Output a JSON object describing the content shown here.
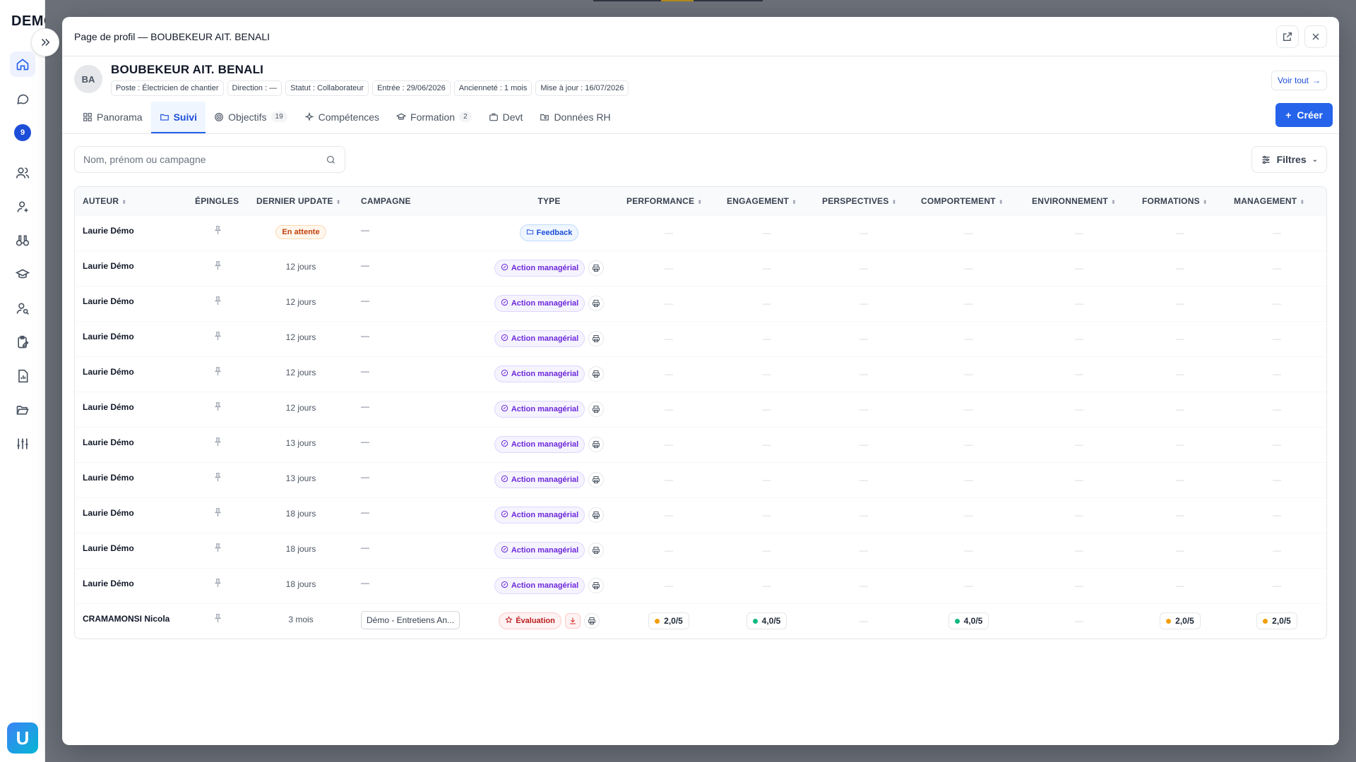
{
  "app": {
    "brand": "DEMO",
    "notif_count": "9"
  },
  "modal": {
    "title": "Page de profil — BOUBEKEUR AIT. BENALI"
  },
  "profile": {
    "initials": "BA",
    "name": "BOUBEKEUR AIT. BENALI",
    "chips": [
      "Poste : Électricien de chantier",
      "Direction : —",
      "Statut : Collaborateur",
      "Entrée : 29/06/2026",
      "Ancienneté : 1 mois",
      "Mise à jour : 16/07/2026"
    ],
    "see_all": "Voir tout"
  },
  "tabs": [
    {
      "label": "Panorama",
      "count": ""
    },
    {
      "label": "Suivi",
      "count": ""
    },
    {
      "label": "Objectifs",
      "count": "19"
    },
    {
      "label": "Compétences",
      "count": ""
    },
    {
      "label": "Formation",
      "count": "2"
    },
    {
      "label": "Devt",
      "count": ""
    },
    {
      "label": "Données RH",
      "count": ""
    }
  ],
  "create_label": "Créer",
  "search": {
    "placeholder": "Nom, prénom ou campagne"
  },
  "filters_label": "Filtres",
  "table": {
    "headers": [
      "AUTEUR",
      "ÉPINGLES",
      "DERNIER UPDATE",
      "CAMPAGNE",
      "TYPE",
      "PERFORMANCE",
      "ENGAGEMENT",
      "PERSPECTIVES",
      "COMPORTEMENT",
      "ENVIRONNEMENT",
      "FORMATIONS",
      "MANAGEMENT"
    ],
    "rows": [
      {
        "author": "Laurie Démo",
        "update": "En attente",
        "campaign": "—",
        "type": "Feedback",
        "scores": [
          "—",
          "—",
          "—",
          "—",
          "—",
          "—",
          "—"
        ]
      },
      {
        "author": "Laurie Démo",
        "update": "12 jours",
        "campaign": "—",
        "type": "Action managérial",
        "scores": [
          "—",
          "—",
          "—",
          "—",
          "—",
          "—",
          "—"
        ]
      },
      {
        "author": "Laurie Démo",
        "update": "12 jours",
        "campaign": "—",
        "type": "Action managérial",
        "scores": [
          "—",
          "—",
          "—",
          "—",
          "—",
          "—",
          "—"
        ]
      },
      {
        "author": "Laurie Démo",
        "update": "12 jours",
        "campaign": "—",
        "type": "Action managérial",
        "scores": [
          "—",
          "—",
          "—",
          "—",
          "—",
          "—",
          "—"
        ]
      },
      {
        "author": "Laurie Démo",
        "update": "12 jours",
        "campaign": "—",
        "type": "Action managérial",
        "scores": [
          "—",
          "—",
          "—",
          "—",
          "—",
          "—",
          "—"
        ]
      },
      {
        "author": "Laurie Démo",
        "update": "12 jours",
        "campaign": "—",
        "type": "Action managérial",
        "scores": [
          "—",
          "—",
          "—",
          "—",
          "—",
          "—",
          "—"
        ]
      },
      {
        "author": "Laurie Démo",
        "update": "13 jours",
        "campaign": "—",
        "type": "Action managérial",
        "scores": [
          "—",
          "—",
          "—",
          "—",
          "—",
          "—",
          "—"
        ]
      },
      {
        "author": "Laurie Démo",
        "update": "13 jours",
        "campaign": "—",
        "type": "Action managérial",
        "scores": [
          "—",
          "—",
          "—",
          "—",
          "—",
          "—",
          "—"
        ]
      },
      {
        "author": "Laurie Démo",
        "update": "18 jours",
        "campaign": "—",
        "type": "Action managérial",
        "scores": [
          "—",
          "—",
          "—",
          "—",
          "—",
          "—",
          "—"
        ]
      },
      {
        "author": "Laurie Démo",
        "update": "18 jours",
        "campaign": "—",
        "type": "Action managérial",
        "scores": [
          "—",
          "—",
          "—",
          "—",
          "—",
          "—",
          "—"
        ]
      },
      {
        "author": "Laurie Démo",
        "update": "18 jours",
        "campaign": "—",
        "type": "Action managérial",
        "scores": [
          "—",
          "—",
          "—",
          "—",
          "—",
          "—",
          "—"
        ]
      },
      {
        "author": "CRAMAMONSI Nicola",
        "update": "3 mois",
        "campaign": "Démo - Entretiens An...",
        "type": "Évaluation",
        "scores": [
          "2,0/5",
          "4,0/5",
          "—",
          "4,0/5",
          "—",
          "2,0/5",
          "2,0/5"
        ]
      }
    ]
  },
  "colors": {
    "accent": "#2563eb",
    "score_orange": "#f59e0b",
    "score_green": "#10b981"
  }
}
